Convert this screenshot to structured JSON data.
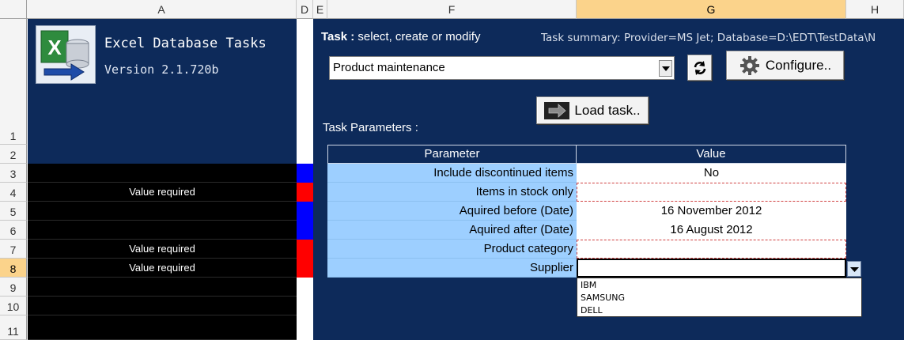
{
  "columns": [
    "A",
    "D",
    "E",
    "F",
    "G",
    "H"
  ],
  "rows": [
    "1",
    "2",
    "3",
    "4",
    "5",
    "6",
    "7",
    "8",
    "9",
    "10",
    "11"
  ],
  "app": {
    "title": "Excel Database Tasks",
    "version": "Version 2.1.720b"
  },
  "status_column": {
    "value_required": "Value required"
  },
  "task": {
    "label_bold": "Task :",
    "label_rest": " select, create or modify",
    "summary": "Task summary: Provider=MS Jet; Database=D:\\EDT\\TestData\\N",
    "selected": "Product maintenance",
    "configure_label": "Configure..",
    "load_label": "Load task.."
  },
  "params": {
    "heading": "Task Parameters :",
    "col_parameter": "Parameter",
    "col_value": "Value",
    "rows": [
      {
        "name": "Include discontinued items",
        "value": ""
      },
      {
        "name": "Items in stock only",
        "value": ""
      },
      {
        "name": "Aquired before  (Date)",
        "value": "16 November 2012"
      },
      {
        "name": "Aquired after (Date)",
        "value": "16 August 2012"
      },
      {
        "name": "Product category",
        "value": ""
      },
      {
        "name": "Supplier",
        "value": ""
      }
    ],
    "first_value": "No"
  },
  "supplier_options": [
    "IBM",
    "SAMSUNG",
    "DELL"
  ],
  "colors": {
    "navy": "#0d2a5a",
    "blue_marker": "#0000ff",
    "red_marker": "#ff0000",
    "param_bg": "#9dcfff",
    "selected_header": "#fbd38b"
  }
}
